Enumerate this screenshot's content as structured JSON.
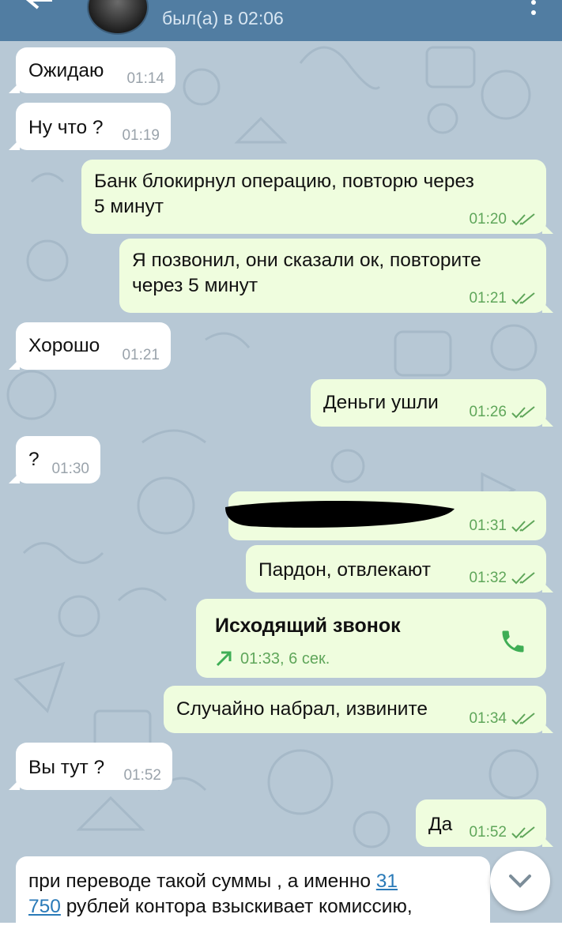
{
  "header": {
    "status": "был(а) в 02:06"
  },
  "messages": [
    {
      "dir": "in",
      "text": "Ожидаю",
      "time": "01:14"
    },
    {
      "dir": "in",
      "text": "Ну что ?",
      "time": "01:19"
    },
    {
      "dir": "out",
      "text_line1": "Банк блокирнул операцию, повторю через",
      "text_line2": "5 минут",
      "time": "01:20"
    },
    {
      "dir": "out",
      "text_line1": "Я позвонил, они сказали ок, повторите",
      "text_line2": "через 5 минут",
      "time": "01:21"
    },
    {
      "dir": "in",
      "text": "Хорошо",
      "time": "01:21"
    },
    {
      "dir": "out",
      "text": "Деньги ушли",
      "time": "01:26"
    },
    {
      "dir": "in",
      "text": "?",
      "time": "01:30"
    },
    {
      "dir": "out",
      "text": "",
      "time": "01:31"
    },
    {
      "dir": "out",
      "text": "Пардон, отвлекают",
      "time": "01:32"
    },
    {
      "dir": "out",
      "text": "Случайно набрал, извините",
      "time": "01:34"
    },
    {
      "dir": "in",
      "text": "Вы тут ?",
      "time": "01:52"
    },
    {
      "dir": "out",
      "text": "Да",
      "time": "01:52"
    }
  ],
  "call": {
    "title": "Исходящий звонок",
    "meta": "01:33, 6 сек."
  },
  "last_message": {
    "part1": "при переводе такой суммы , а именно ",
    "link1": "31",
    "link2": "750",
    "part2": " рублей контора взыскивает комиссию,"
  },
  "colors": {
    "header": "#517da2",
    "incoming_bubble": "#ffffff",
    "outgoing_bubble": "#effdde",
    "time_outgoing": "#5fa65a",
    "link": "#2a7ab8"
  }
}
